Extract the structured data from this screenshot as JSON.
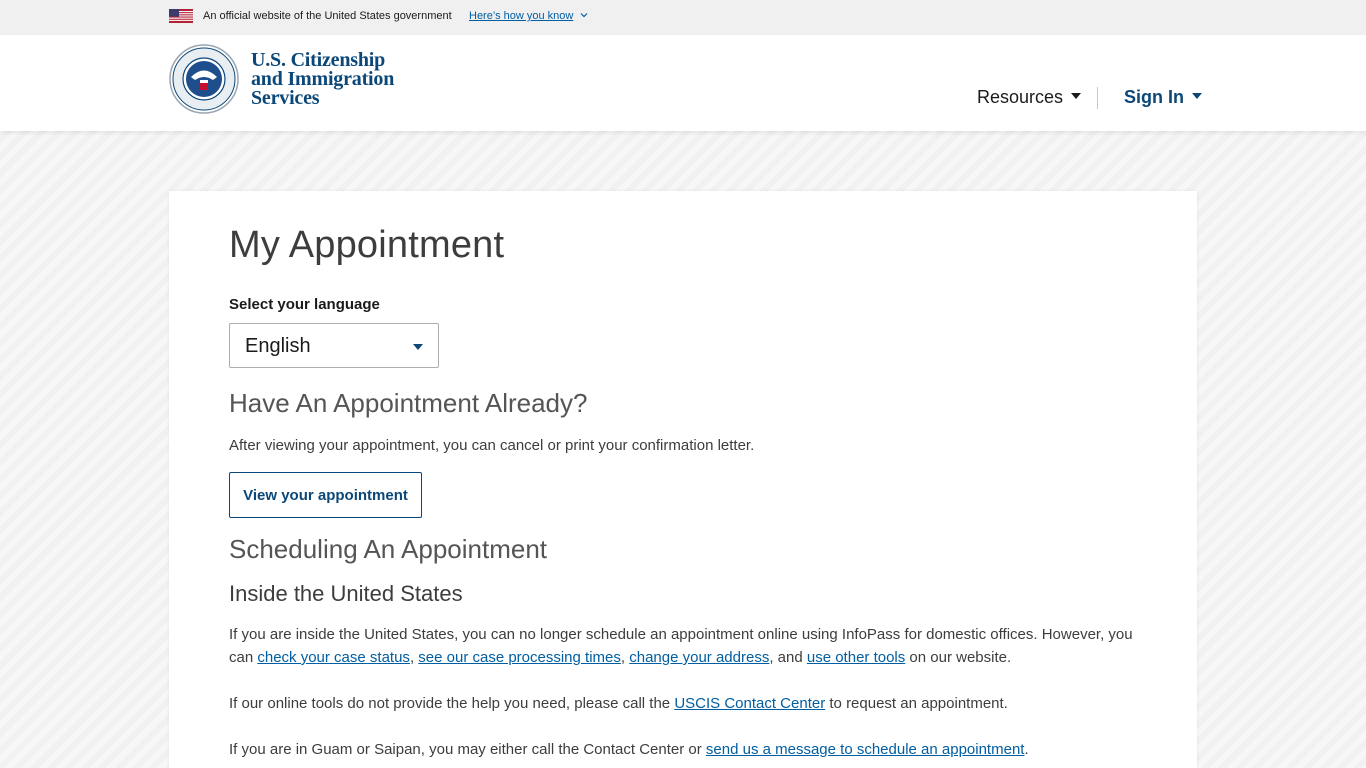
{
  "gov_banner": {
    "official_text": "An official website of the United States government",
    "how_link": "Here’s how you know"
  },
  "header": {
    "agency_line1": "U.S. Citizenship",
    "agency_line2": "and Immigration",
    "agency_line3": "Services",
    "seal_text": "U.S. DEPARTMENT OF HOMELAND SECURITY",
    "nav": {
      "resources_label": "Resources",
      "signin_label": "Sign In"
    }
  },
  "main": {
    "title": "My Appointment",
    "language": {
      "label": "Select your language",
      "selected": "English"
    },
    "have_appointment": {
      "heading": "Have An Appointment Already?",
      "description": "After viewing your appointment, you can cancel or print your confirmation letter.",
      "button_label": "View your appointment"
    },
    "scheduling": {
      "heading": "Scheduling An Appointment",
      "subheading": "Inside the United States",
      "inside_text_1": "If you are inside the United States, you can no longer schedule an appointment online using InfoPass for domestic offices. However, you can ",
      "link_case_status": "check your case status",
      "sep1": ", ",
      "link_processing_times": "see our case processing times",
      "sep2": ", ",
      "link_change_address": "change your address",
      "sep3": ", and ",
      "link_other_tools": "use other tools",
      "inside_text_2": " on our website.",
      "online_text_1": "If our online tools do not provide the help you need, please call the ",
      "link_contact_center": "USCIS Contact Center",
      "online_text_2": " to request an appointment.",
      "guam_text_1": "If you are in Guam or Saipan, you may either call the Contact Center or ",
      "link_send_message": "send us a message to schedule an appointment",
      "guam_text_2": "."
    }
  },
  "colors": {
    "brand_navy": "#0b4778",
    "link_blue": "#005ea2"
  }
}
